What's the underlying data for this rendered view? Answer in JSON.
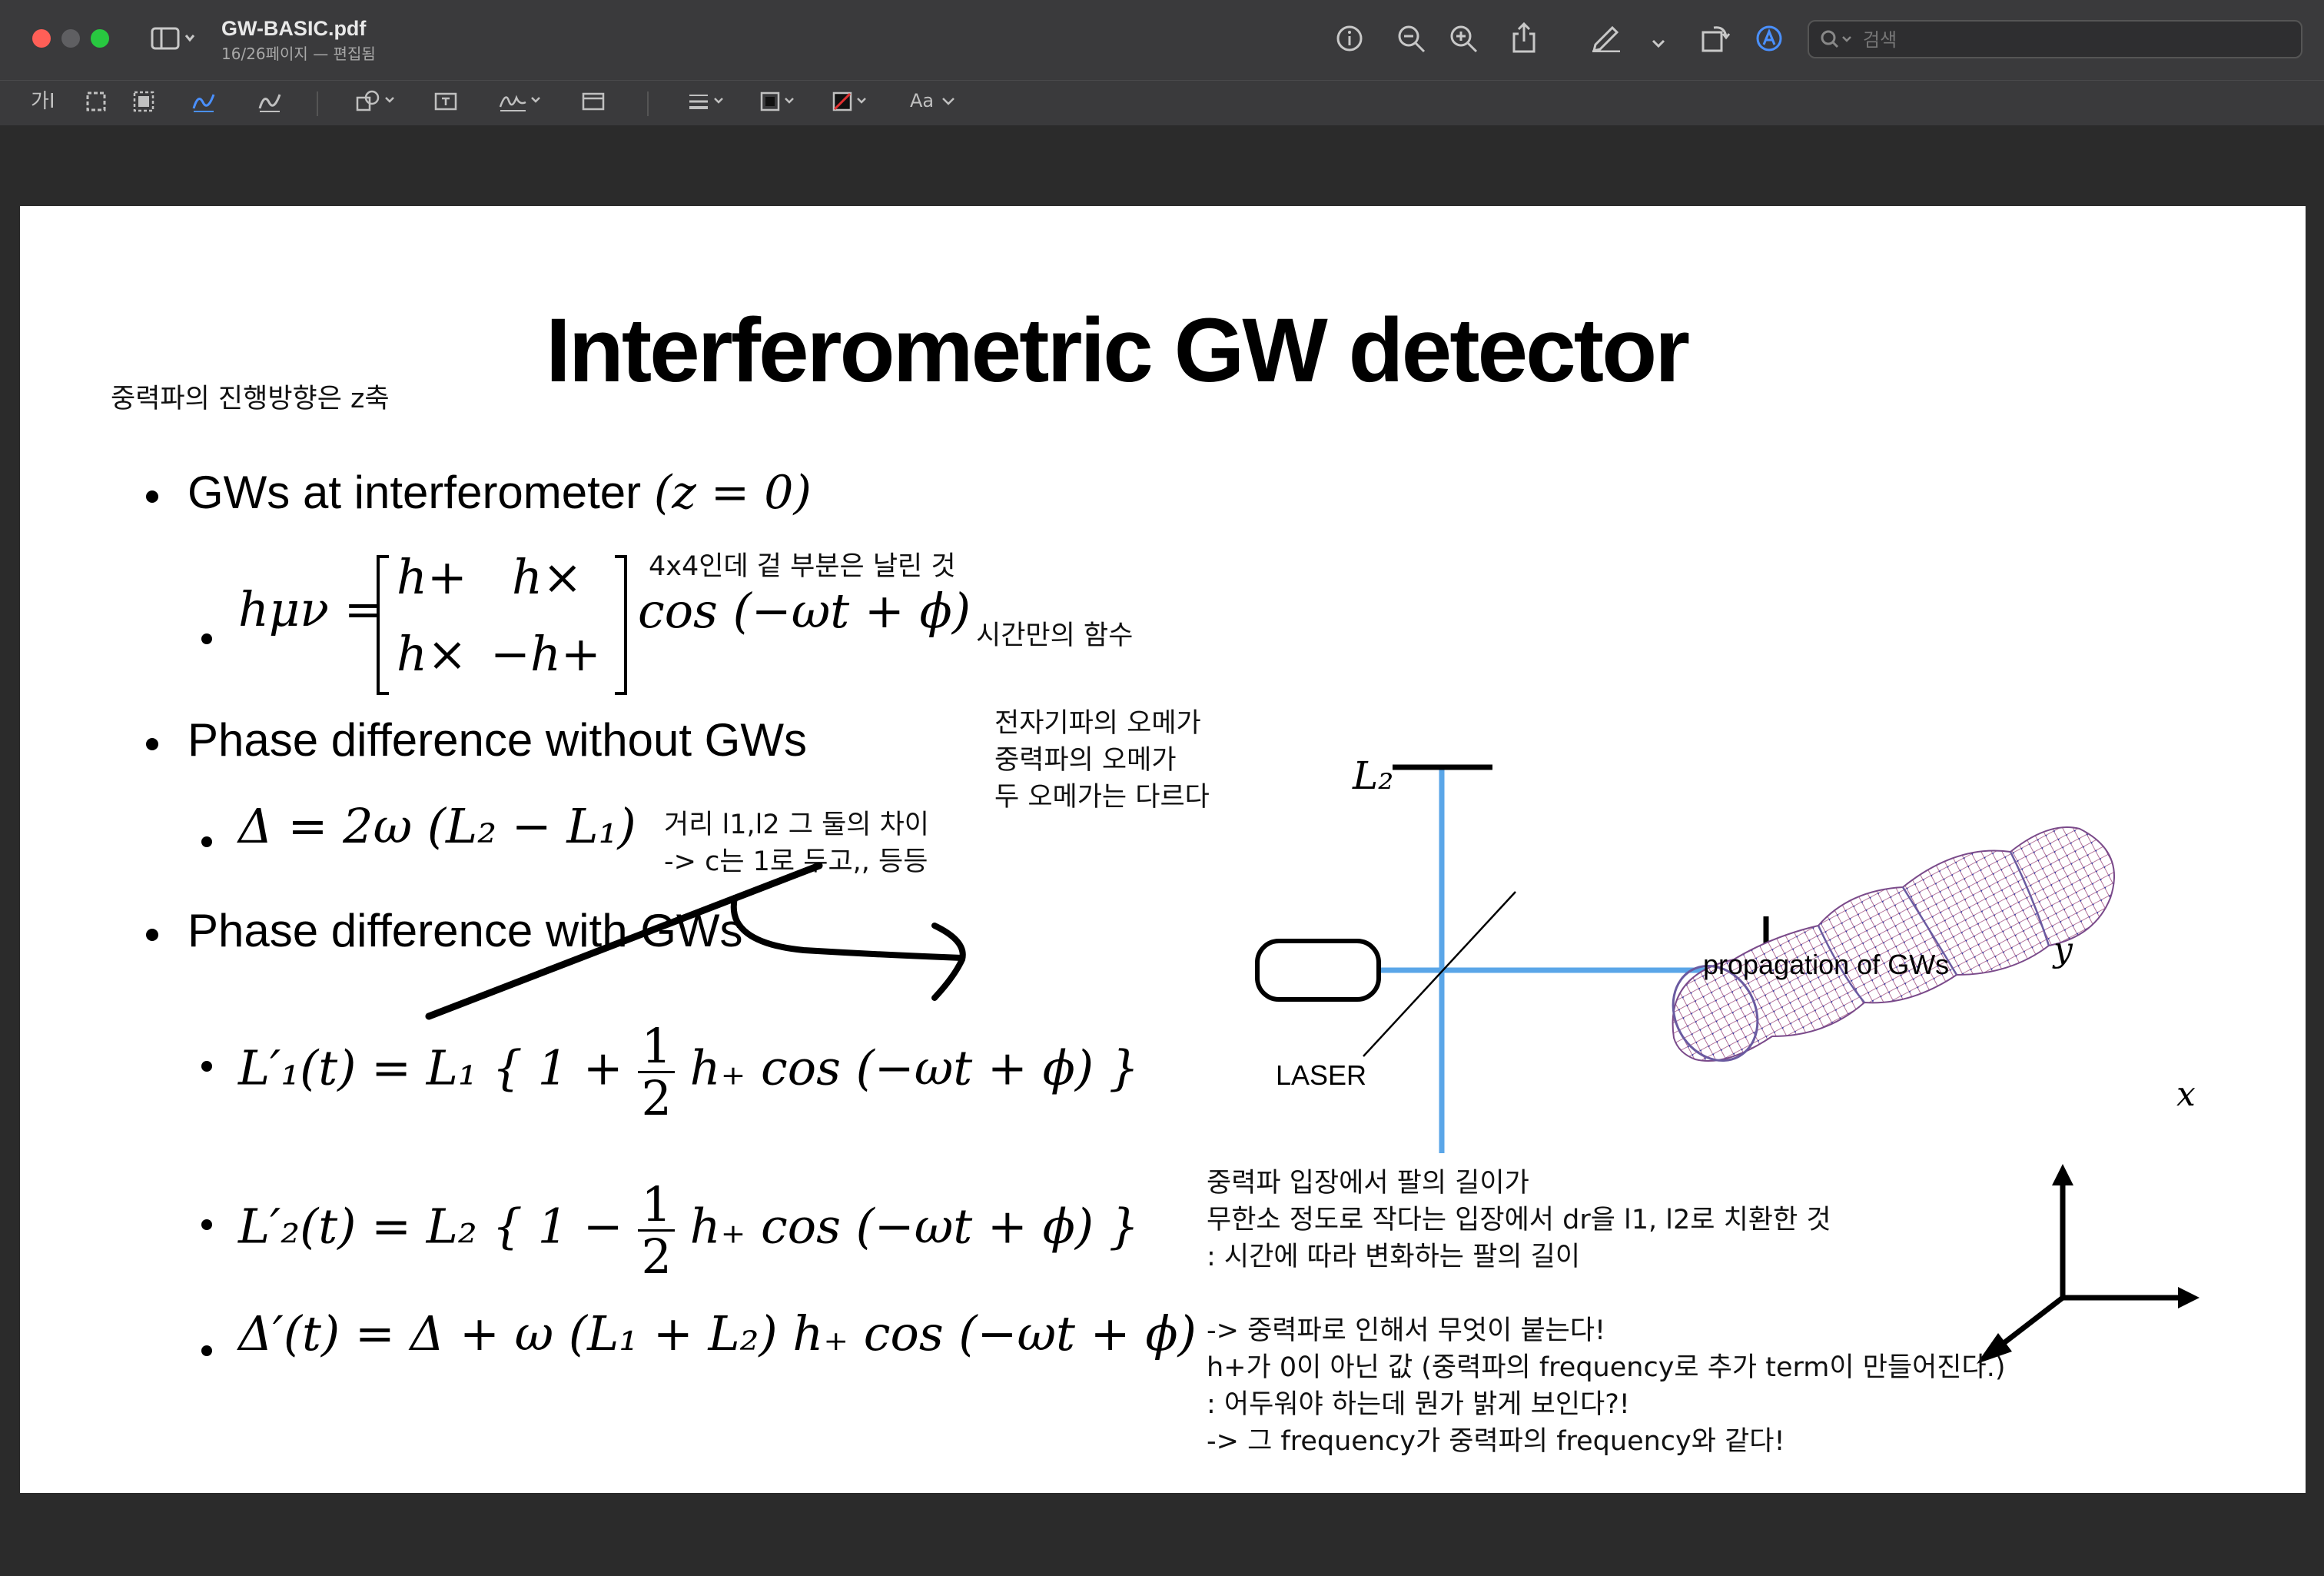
{
  "window": {
    "file_name": "GW-BASIC.pdf",
    "subtitle": "16/26페이지 — 편집됨",
    "search_placeholder": "검색"
  },
  "toolbar": {
    "text_tool_label": "가",
    "font_label": "Aa"
  },
  "slide": {
    "title": "Interferometric GW detector",
    "bullets": {
      "b1": "GWs at interferometer",
      "b1_math": "(z = 0)",
      "b2": "Phase difference without GWs",
      "b3": "Phase difference with GWs"
    },
    "math": {
      "h_lhs": "hμν =",
      "m11": "h+",
      "m12": "h×",
      "m21": "h×",
      "m22": "−h+",
      "cos_term": "cos (−ωt + ϕ)",
      "delta": "Δ = 2ω (L₂ − L₁)",
      "l1_lhs": "L′₁(t) = L₁ { 1 +",
      "l2_lhs": "L′₂(t) = L₂ { 1 −",
      "half_num": "1",
      "half_den": "2",
      "l_tail": "h₊ cos (−ωt + ϕ) }",
      "delta_prime": "Δ′(t) = Δ + ω (L₁ + L₂) h₊ cos (−ωt + ϕ)"
    },
    "diagram": {
      "l2_label": "L₂",
      "laser_label": "LASER",
      "propagation_label": "propagation of GWs",
      "axis_y": "y",
      "axis_x": "x",
      "beam_color": "#5aa6e8"
    }
  },
  "annotations": {
    "z_axis": "중력파의 진행방향은 z축",
    "matrix": "4x4인데 겉 부분은 날린 것",
    "time_only": "시간만의 함수",
    "omega_1": "전자기파의 오메가",
    "omega_2": "중력파의 오메가",
    "omega_3": "두 오메가는 다르다",
    "dist_1": "거리 l1,l2 그 둘의 차이",
    "dist_2": "-> c는 1로 두고,, 등등",
    "arm_1": "중력파 입장에서 팔의 길이가",
    "arm_2": "무한소 정도로 작다는 입장에서 dr을 l1, l2로 치환한 것",
    "arm_3": ": 시간에 따라 변화하는 팔의 길이",
    "res_1": "-> 중력파로 인해서 무엇이 붙는다!",
    "res_2": "h+가 0이 아닌 값 (중력파의 frequency로 추가 term이 만들어진다.)",
    "res_3": ": 어두워야 하는데 뭔가 밝게 보인다?!",
    "res_4": "-> 그 frequency가 중력파의 frequency와 같다!"
  }
}
